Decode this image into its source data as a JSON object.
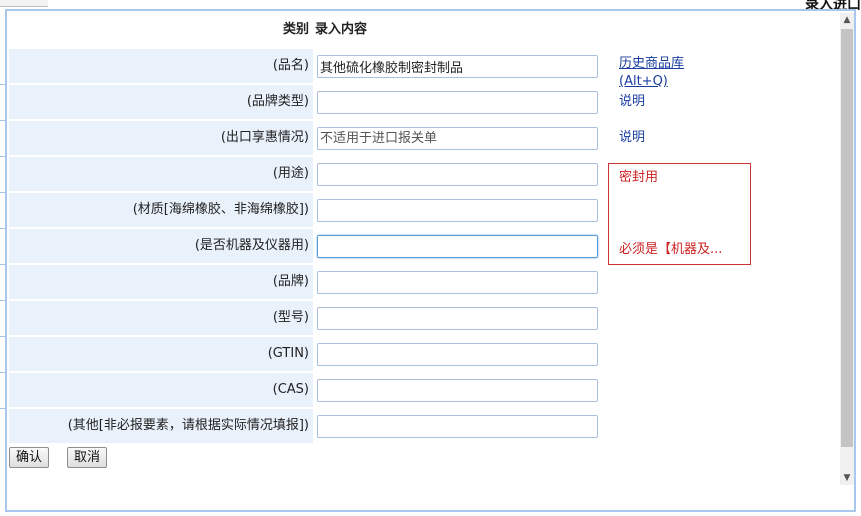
{
  "background": {
    "page_title": "录入进口"
  },
  "dialog": {
    "header": {
      "col_category": "类别",
      "col_content": "录入内容"
    },
    "rows": [
      {
        "label": "(品名)",
        "value": "其他硫化橡胶制密封制品",
        "placeholder": ""
      },
      {
        "label": "(品牌类型)",
        "value": "",
        "placeholder": ""
      },
      {
        "label": "(出口享惠情况)",
        "value": "",
        "placeholder": "不适用于进口报关单"
      },
      {
        "label": "(用途)",
        "value": "",
        "placeholder": ""
      },
      {
        "label": "(材质[海绵橡胶、非海绵橡胶])",
        "value": "",
        "placeholder": ""
      },
      {
        "label": "(是否机器及仪器用)",
        "value": "",
        "placeholder": ""
      },
      {
        "label": "(品牌)",
        "value": "",
        "placeholder": ""
      },
      {
        "label": "(型号)",
        "value": "",
        "placeholder": ""
      },
      {
        "label": "(GTIN)",
        "value": "",
        "placeholder": ""
      },
      {
        "label": "(CAS)",
        "value": "",
        "placeholder": ""
      },
      {
        "label": "(其他[非必报要素，请根据实际情况填报])",
        "value": "",
        "placeholder": ""
      }
    ],
    "side": {
      "history_link_line1": "历史商品库",
      "history_link_line2": "(Alt+Q)",
      "brand_type_note": "说明",
      "export_pref_note": "说明",
      "hint_usage": "密封用",
      "hint_machine": "必须是【机器及..."
    },
    "buttons": {
      "confirm": "确认",
      "cancel": "取消"
    }
  },
  "colors": {
    "label_bg": "#e9f1fb",
    "link": "#1a3ea0",
    "hint_red": "#cc2222",
    "dialog_border": "#a8c7ea"
  }
}
